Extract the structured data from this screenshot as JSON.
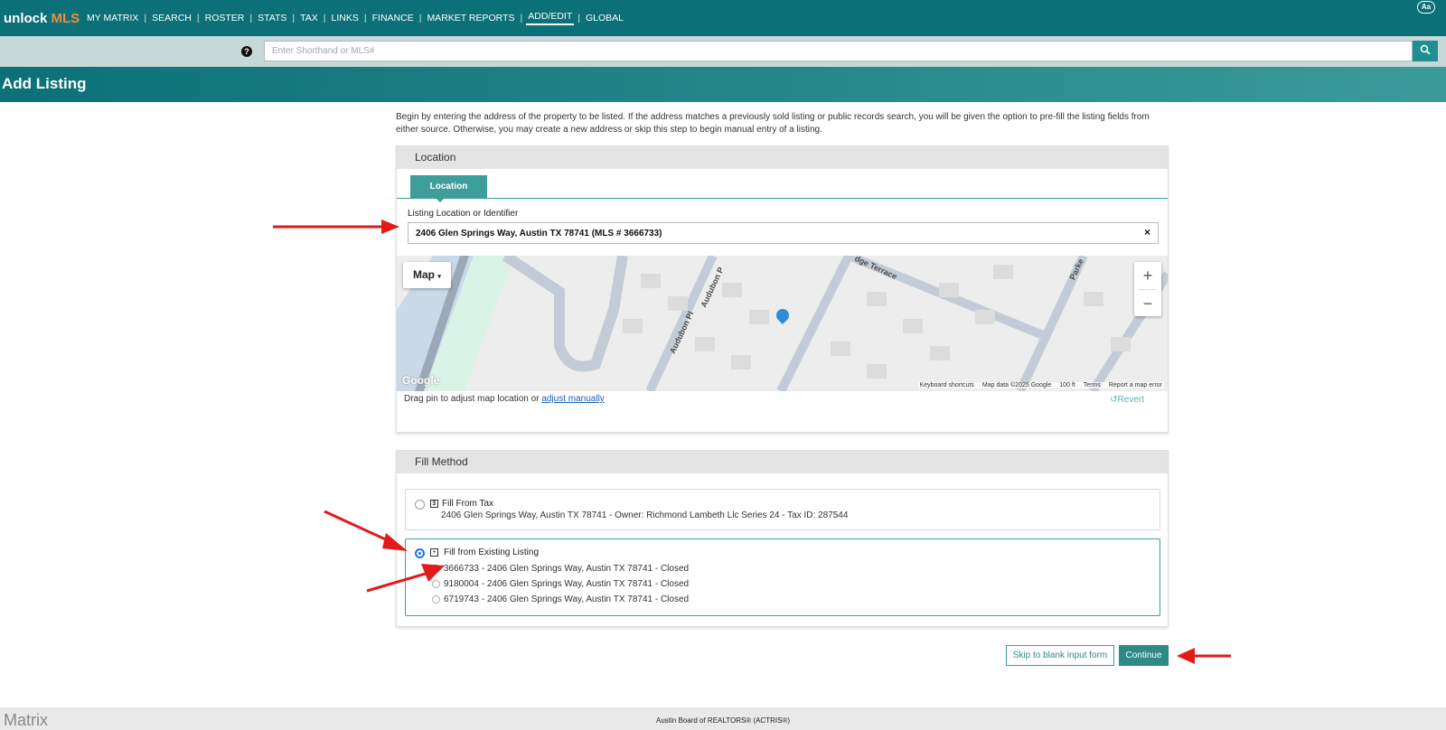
{
  "nav": {
    "logo_a": "unlock ",
    "logo_b": "MLS",
    "items": [
      "MY MATRIX",
      "SEARCH",
      "ROSTER",
      "STATS",
      "TAX",
      "LINKS",
      "FINANCE",
      "MARKET REPORTS",
      "ADD/EDIT",
      "GLOBAL"
    ],
    "active": "ADD/EDIT",
    "font_button": "Aa"
  },
  "search": {
    "placeholder": "Enter Shorthand or MLS#",
    "help_icon": "question-circle-icon",
    "button_icon": "search-icon"
  },
  "page": {
    "title": "Add Listing",
    "intro": "Begin by entering the address of the property to be listed. If the address matches a previously sold listing or public records search, you will be given the option to pre-fill the listing fields from either source. Otherwise, you may create a new address or skip this step to begin manual entry of a listing."
  },
  "location": {
    "panel_title": "Location",
    "tab": "Location",
    "field_label": "Listing Location or Identifier",
    "field_value": "2406 Glen Springs Way, Austin TX 78741 (MLS # 3666733)",
    "clear": "×",
    "map": {
      "type_button": "Map",
      "zoom_in": "+",
      "zoom_out": "−",
      "streets": [
        "Audubon Pl",
        "Audubon P",
        "dge Terrace",
        "Parke"
      ],
      "google": "Google",
      "footer": [
        "Keyboard shortcuts",
        "Map data ©2025 Google",
        "100 ft",
        "Terms",
        "Report a map error"
      ]
    },
    "note": "Drag pin to adjust map location or ",
    "note_link": "adjust manually",
    "revert": "Revert"
  },
  "fill": {
    "panel_title": "Fill Method",
    "tax": {
      "title": "Fill From Tax",
      "detail": "2406 Glen Springs Way, Austin TX 78741 - Owner: Richmond Lambeth Llc Series 24 - Tax ID: 287544",
      "selected": false
    },
    "existing": {
      "title": "Fill from Existing Listing",
      "selected": true,
      "listings": [
        {
          "label": "3666733 - 2406 Glen Springs Way, Austin TX 78741 - Closed",
          "selected": true
        },
        {
          "label": "9180004 - 2406 Glen Springs Way, Austin TX 78741 - Closed",
          "selected": false
        },
        {
          "label": "6719743 - 2406 Glen Springs Way, Austin TX 78741 - Closed",
          "selected": false
        }
      ]
    }
  },
  "actions": {
    "skip": "Skip to blank input form",
    "continue": "Continue"
  },
  "footer": {
    "logo": "Matrix",
    "center": "Austin Board of REALTORS® (ACTRIS®)"
  },
  "colors": {
    "nav_bg": "#0b7078",
    "accent": "#3d9e9b",
    "logo_accent": "#f28b3c",
    "annotation": "#e11b1b"
  }
}
